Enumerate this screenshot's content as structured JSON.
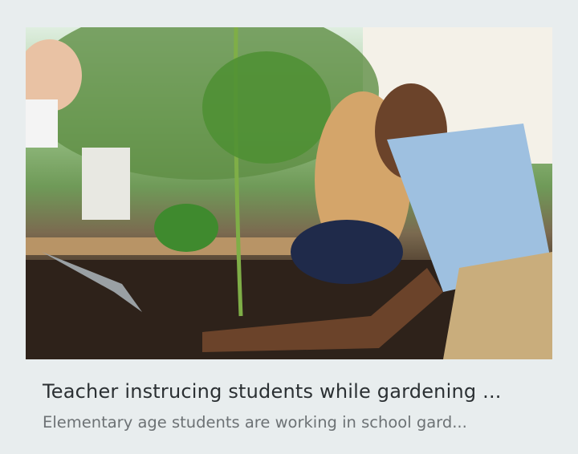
{
  "card": {
    "title": "Teacher instrucing students while gardening ...",
    "subtitle": "Elementary age students are working in school gard..."
  }
}
